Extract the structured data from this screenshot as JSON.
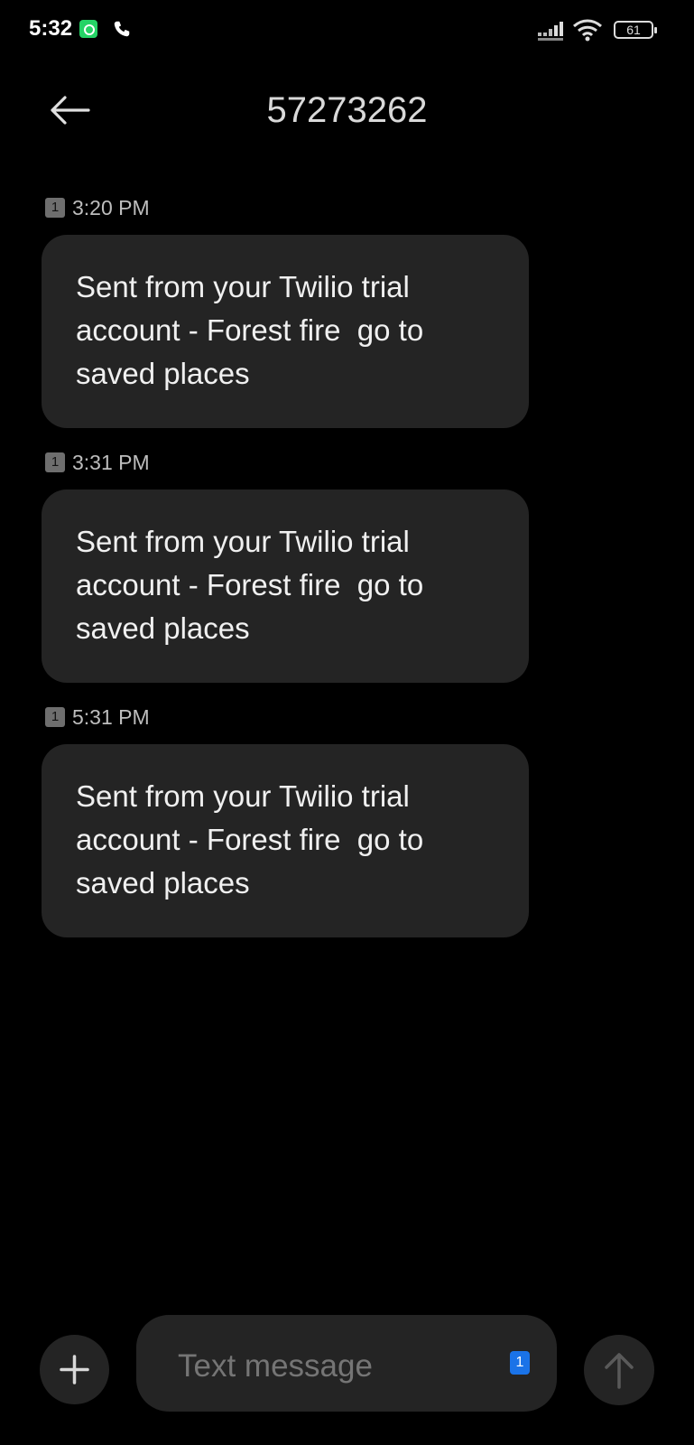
{
  "status_bar": {
    "time": "5:32",
    "battery_level": "61",
    "icons": [
      "whatsapp-icon",
      "phone-icon",
      "signal-icon",
      "wifi-icon",
      "battery-icon"
    ]
  },
  "header": {
    "title": "57273262",
    "back_icon": "arrow-left-icon"
  },
  "messages": [
    {
      "sim": "1",
      "time": "3:20 PM",
      "text": "Sent from your Twilio trial\naccount - Forest fire  go to\nsaved places"
    },
    {
      "sim": "1",
      "time": "3:31 PM",
      "text": "Sent from your Twilio trial\naccount - Forest fire  go to\nsaved places"
    },
    {
      "sim": "1",
      "time": "5:31 PM",
      "text": "Sent from your Twilio trial\naccount - Forest fire  go to\nsaved places"
    }
  ],
  "composer": {
    "placeholder": "Text message",
    "sim": "1",
    "attach_icon": "plus-icon",
    "send_icon": "arrow-up-icon"
  },
  "colors": {
    "background": "#000000",
    "bubble": "#242424",
    "sim_accent": "#1a73e8"
  }
}
